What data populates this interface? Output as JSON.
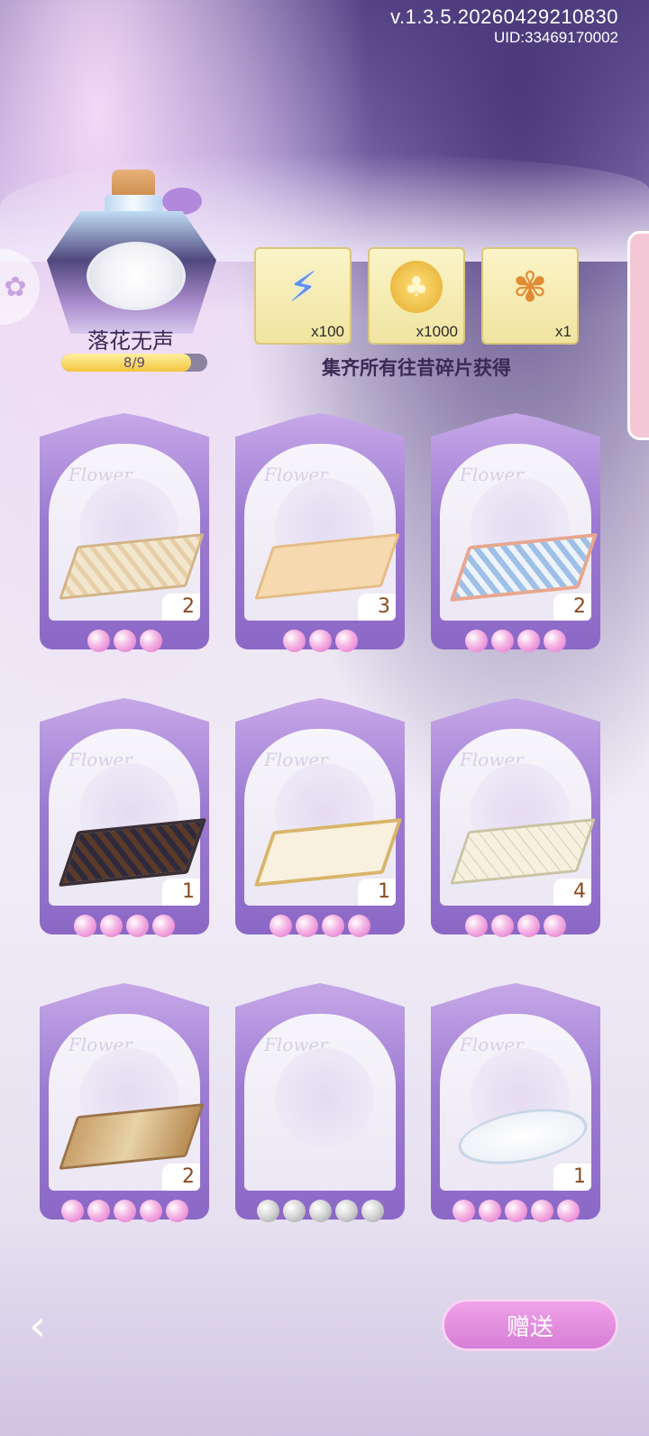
{
  "header": {
    "version": "v.1.3.5.20260429210830",
    "uid": "UID:33469170002"
  },
  "collection": {
    "name": "落花无声",
    "progress_text": "8/9",
    "progress_fraction": 0.889
  },
  "rewards": [
    {
      "icon": "energy-bolt-icon",
      "qty": "x100"
    },
    {
      "icon": "gold-coin-icon",
      "qty": "x1000"
    },
    {
      "icon": "flower-horn-icon",
      "qty": "x1"
    }
  ],
  "reward_caption": "集齐所有往昔碎片获得",
  "cards": [
    {
      "count": "2",
      "pearls": 3,
      "owned": true,
      "rug": "beige-ornate"
    },
    {
      "count": "3",
      "pearls": 3,
      "owned": true,
      "rug": "peach-plain"
    },
    {
      "count": "2",
      "pearls": 4,
      "owned": true,
      "rug": "blue-pattern"
    },
    {
      "count": "1",
      "pearls": 4,
      "owned": true,
      "rug": "dark-persian"
    },
    {
      "count": "1",
      "pearls": 4,
      "owned": true,
      "rug": "cream-border"
    },
    {
      "count": "4",
      "pearls": 4,
      "owned": true,
      "rug": "cream-grid"
    },
    {
      "count": "2",
      "pearls": 5,
      "owned": true,
      "rug": "tan-geometric"
    },
    {
      "count": "",
      "pearls": 5,
      "owned": false,
      "rug": ""
    },
    {
      "count": "1",
      "pearls": 5,
      "owned": true,
      "rug": "white-oval"
    }
  ],
  "card_watermark": "Flower",
  "footer": {
    "gift_label": "赠送"
  }
}
